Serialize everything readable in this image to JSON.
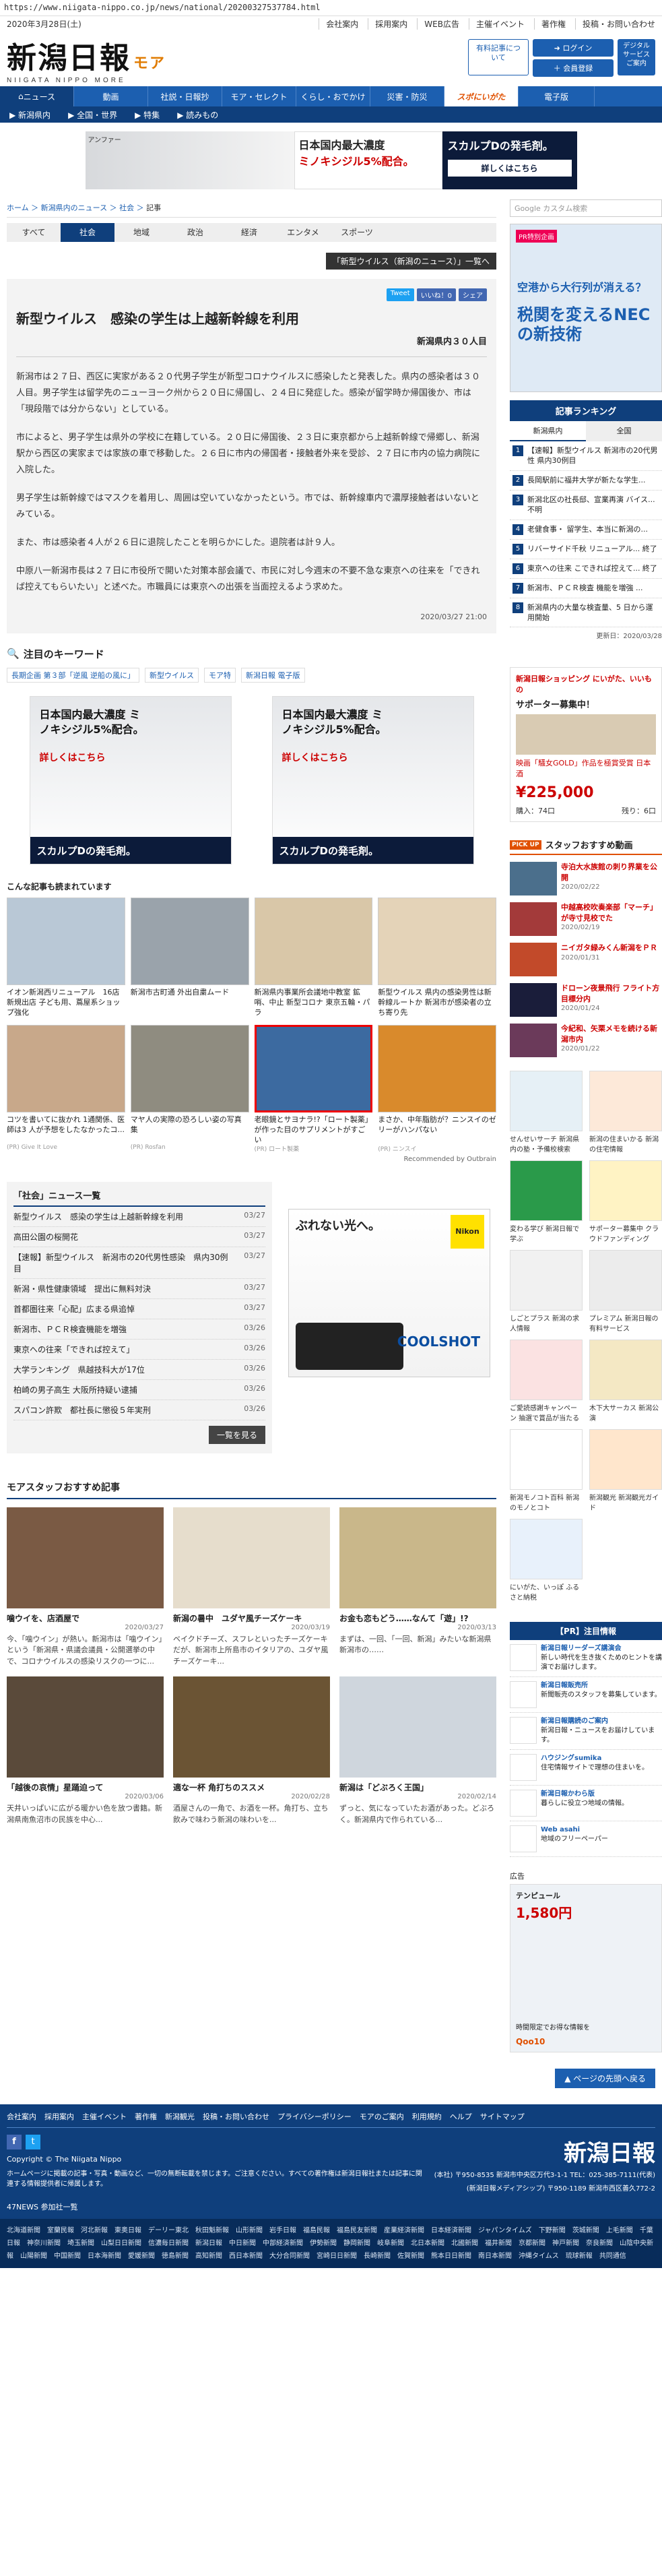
{
  "url": "https://www.niigata-nippo.co.jp/news/national/20200327537784.html",
  "date_display": "2020年3月28日(土)",
  "top_links": [
    "会社案内",
    "採用案内",
    "WEB広告",
    "主催イベント",
    "著作権",
    "投稿・お問い合わせ"
  ],
  "logo": {
    "main": "新潟日報",
    "more": "モア",
    "sub": "NIIGATA NIPPO MORE"
  },
  "header_buttons": {
    "member_check": "有料記事について",
    "login": "ログイン",
    "register": "会員登録",
    "digital": "デジタルサービスご案内"
  },
  "global_nav": [
    "ニュース",
    "動画",
    "社説・日報抄",
    "モア・セレクト",
    "くらし・おでかけ",
    "災害・防災",
    "スポにいがた",
    "電子版"
  ],
  "sub_nav": [
    "新潟県内",
    "全国・世界",
    "特集",
    "読みもの"
  ],
  "top_ad": {
    "brand": "アンファー",
    "headline": "日本国内最大濃度",
    "product": "ミノキシジル5%配合。",
    "cta": "スカルプDの発毛剤。",
    "button": "詳しくはこちら"
  },
  "breadcrumb": [
    "ホーム",
    "新潟県内のニュース",
    "社会",
    "記事"
  ],
  "category_tabs": [
    "すべて",
    "社会",
    "地域",
    "政治",
    "経済",
    "エンタメ",
    "スポーツ"
  ],
  "special_button": "「新型ウイルス（新潟のニュース）」一覧へ",
  "share": {
    "tweet": "Tweet",
    "like": "いいね！0",
    "share": "シェア"
  },
  "article": {
    "title": "新型ウイルス　感染の学生は上越新幹線を利用",
    "subtitle": "新潟県内３０人目",
    "paragraphs": [
      "新潟市は２７日、西区に実家がある２０代男子学生が新型コロナウイルスに感染したと発表した。県内の感染者は３０人目。男子学生は留学先のニューヨーク州から２０日に帰国し、２４日に発症した。感染が留学時か帰国後か、市は「現段階では分からない」としている。",
      "市によると、男子学生は県外の学校に在籍している。２０日に帰国後、２３日に東京都から上越新幹線で帰郷し、新潟駅から西区の実家までは家族の車で移動した。２６日に市内の帰国者・接触者外来を受診、２７日に市内の協力病院に入院した。",
      "男子学生は新幹線ではマスクを着用し、周囲は空いていなかったという。市では、新幹線車内で濃厚接触者はいないとみている。",
      "また、市は感染者４人が２６日に退院したことを明らかにした。退院者は計９人。",
      "中原八一新潟市長は２７日に市役所で開いた対策本部会議で、市民に対し今週末の不要不急な東京への往来を「できれば控えてもらいたい」と述べた。市職員には東京への出張を当面控えるよう求めた。"
    ],
    "date": "2020/03/27 21:00"
  },
  "keywords": {
    "heading": "注目のキーワード",
    "items": [
      "長期企画 第３部「逆風 逆船の風に」",
      "新型ウイルス",
      "モア特",
      "新潟日報 電子版"
    ]
  },
  "mid_ads": [
    {
      "headline": "日本国内最大濃度 ミノキシジル5%配合。",
      "sub": "スカルプDの発毛剤。",
      "button": "詳しくはこちら"
    },
    {
      "headline": "日本国内最大濃度 ミノキシジル5%配合。",
      "sub": "スカルプDの発毛剤。",
      "button": "詳しくはこちら"
    }
  ],
  "recommend": {
    "heading": "こんな記事も読まれています",
    "items": [
      {
        "caption": "イオン新潟西リニューアル　16店新規出店 子ども用、蔦屋系ショップ強化",
        "source": "",
        "color": "#b9c8d6"
      },
      {
        "caption": "新潟市古町通 外出自粛ムード",
        "source": "",
        "color": "#9aa3ab"
      },
      {
        "caption": "新潟県内事業所会議地中教室 鉱哨、中止 新型コロナ 東京五輪・パラ",
        "source": "",
        "color": "#d9c7a8"
      },
      {
        "caption": "新型ウイルス 県内の感染男性は新幹線ルートか 新潟市が感染者の立ち寄り先",
        "source": "",
        "color": "#e4d3b8"
      },
      {
        "caption": "コツを書いてに抜かれ 1通関係、医師は3 人が予想をしたなかったコ...",
        "source": "(PR) Give It Love",
        "color": "#c8a88a"
      },
      {
        "caption": "マヤ人の実際の恐ろしい姿の写真集",
        "source": "(PR) Rosfan",
        "color": "#8f8c80"
      },
      {
        "caption": "老眼鏡とサヨナラ!?「ロート製薬」が作った目のサプリメントがすごい",
        "source": "(PR) ロート製薬",
        "color": "#3c6aa0"
      },
      {
        "caption": "まさか、中年脂肪が？ニンスイのゼリーがハンパない",
        "source": "(PR) ニンスイ",
        "color": "#d98a2c"
      }
    ],
    "recommended_by": "Recommended by Outbrain"
  },
  "news_list": {
    "heading": "「社会」ニュース一覧",
    "rows": [
      {
        "title": "新型ウイルス　感染の学生は上越新幹線を利用",
        "date": "03/27"
      },
      {
        "title": "高田公園の桜開花",
        "date": "03/27"
      },
      {
        "title": "【速報】新型ウイルス　新潟市の20代男性感染　県内30例目",
        "date": "03/27"
      },
      {
        "title": "新潟・県性健康領域　提出に無料対決",
        "date": "03/27"
      },
      {
        "title": "首都圏往来「心配」広まる県追悼",
        "date": "03/27"
      },
      {
        "title": "新潟市、ＰＣＲ検査機能を増強",
        "date": "03/26"
      },
      {
        "title": "東京への往来「できれば控えて」",
        "date": "03/26"
      },
      {
        "title": "大学ランキング　県越技科大が17位",
        "date": "03/26"
      },
      {
        "title": "柏崎の男子高生 大阪所持疑い逮捕",
        "date": "03/26"
      },
      {
        "title": "スパコン許欺　都社長に懲役５年実刑",
        "date": "03/26"
      }
    ],
    "more": "一覧を見る"
  },
  "nikon_ad": {
    "headline": "ぶれない光へ。",
    "brand": "Nikon",
    "product": "COOLSHOT"
  },
  "staff": {
    "heading": "モアスタッフおすすめ記事",
    "items": [
      {
        "title": "噛ウイを、店酒屋で",
        "date": "2020/03/27",
        "desc": "今、「噛ウイン」が熱い。新潟市は「噛ウイン」という「新潟県・県議会議員・公開選挙の中で、コロナウイルスの感染リスクの一つに...",
        "color": "#7a5a44"
      },
      {
        "title": "新潟の暑中　ユダヤ風チーズケーキ",
        "date": "2020/03/19",
        "desc": "ベイクドチーズ、スフレといったチーズケーキだが、新潟市上所島市のイタリアの、ユダヤ風チーズケーキ...",
        "color": "#e6ddcc"
      },
      {
        "title": "お金も恋もどう……なんて「遊」!?",
        "date": "2020/03/13",
        "desc": "まずは、一回、「一回、新潟」みたいな新潟県新潟市の……",
        "color": "#c9b78a"
      },
      {
        "title": "「越後の哀情」星踊迫って",
        "date": "2020/03/06",
        "desc": "天井いっぱいに広がる暖かい色を放つ書籍。新潟県南魚沼市の民族を中心...",
        "color": "#5a4a3a"
      },
      {
        "title": "適な一杯 角打ちのススメ",
        "date": "2020/02/28",
        "desc": "酒屋さんの一角で、お酒を一杯。角打ち、立ち飲みで味わう新潟の味わいを...",
        "color": "#6b5434"
      },
      {
        "title": "新潟は「どぶろく王国」",
        "date": "2020/02/14",
        "desc": "ずっと、気になっていたお酒があった。どぶろく。新潟県内で作られている...",
        "color": "#cfd6dd"
      }
    ]
  },
  "sidebar": {
    "search_placeholder": "Google カスタム検索",
    "ad_top": {
      "tag": "PR特別企画",
      "question": "空港から大行列が消える？",
      "big": "税関を変えるNECの新技術"
    },
    "ranking": {
      "heading": "記事ランキング",
      "tabs": [
        "新潟県内",
        "全国"
      ],
      "items": [
        "【速報】新型ウイルス 新潟市の20代男性 県内30例目",
        "長岡駅前に福井大学が新たな学生...",
        "新潟北区の社長邸、宣業再演 バイス... 不明",
        "老健食事・ 留学生、本当に新潟の...",
        "リバーサイド千秋 リニューアル... 終了",
        "東京への往来 こできれば控えて... 終了",
        "新潟市、ＰＣＲ検査 機能を増強 ...",
        "新潟県内の大量な検査量、5 日から運用開始"
      ],
      "updated": "更新日：2020/03/28"
    },
    "shop": {
      "heading": "新潟日報ショッピング にいがた、いいもの",
      "label": "サポーター募集中！",
      "title": "映画「騒女GOLD」作品を極賞受賞 日本酒",
      "price": "¥225,000",
      "sub_left": "購入：74口",
      "sub_right": "残り：6口"
    },
    "staff_pick": {
      "heading": "スタッフおすすめ動画",
      "items": [
        {
          "title": "寺泊大水族館の刺り界業を公開",
          "date": "2020/02/22",
          "color": "#4b6f8c"
        },
        {
          "title": "中越高校吹奏楽部「マーチ」が寺寸見校でた",
          "date": "2020/02/19",
          "color": "#a33a3a"
        },
        {
          "title": "ニイガタ緑みくん新潟をＰＲ",
          "date": "2020/01/31",
          "color": "#c24a2a"
        },
        {
          "title": "ドローン夜景飛行 フライト方目標分内",
          "date": "2020/01/24",
          "color": "#1a1d3a"
        },
        {
          "title": "今紀和、矢栗メモを続ける新潟市内",
          "date": "2020/01/22",
          "color": "#6b3a5a"
        }
      ]
    },
    "banners": [
      {
        "label": "せんせいサーチ 新潟県内の塾・予備校検索",
        "color": "#e6f0f6"
      },
      {
        "label": "新潟の住まいかる 新潟の住宅情報",
        "color": "#fde9d9"
      },
      {
        "label": "変わる学び 新潟日報で学ぶ",
        "color": "#2a9a4a"
      },
      {
        "label": "サポーター募集中 クラウドファンディング",
        "color": "#fff3c4"
      },
      {
        "label": "しごとプラス 新潟の求人情報",
        "color": "#f1f1f1"
      },
      {
        "label": "プレミアム 新潟日報の有料サービス",
        "color": "#ececec"
      },
      {
        "label": "ご愛読感謝キャンペーン 抽選で賞品が当たる",
        "color": "#fbe2e2"
      },
      {
        "label": "木下大サーカス 新潟公演",
        "color": "#f4e8c4"
      },
      {
        "label": "新潟モノコト百科 新潟のモノとコト",
        "color": "#ffffff"
      },
      {
        "label": "新潟観光 新潟観光ガイド",
        "color": "#ffe6cc"
      },
      {
        "label": "にいがた、いっぽ ふるさと納税",
        "color": "#e8f1fb"
      }
    ],
    "pr_heading": "【PR】注目情報",
    "pr_items": [
      {
        "title": "新潟日報リーダーズ講演会",
        "text": "新しい時代を生き抜くためのヒントを講演でお届けします。"
      },
      {
        "title": "新潟日報販売所",
        "text": "新聞販売のスタッフを募集しています。"
      },
      {
        "title": "新潟日報購読のご案内",
        "text": "新潟日報・ニュースをお届けしています。"
      },
      {
        "title": "ハウジングsumika",
        "text": "住宅情報サイトで理想の住まいを。"
      },
      {
        "title": "新潟日報かわら版",
        "text": "暮らしに役立つ地域の情報。"
      },
      {
        "title": "Web asahi",
        "text": "地域のフリーペーパー"
      }
    ],
    "ad_label": "広告",
    "tempur": {
      "brand": "テンピュール",
      "price": "1,580円",
      "caption": "時間限定でお得な情報を",
      "logo": "Qoo10"
    }
  },
  "pagetop": "ページの先頭へ戻る",
  "footer": {
    "links": [
      "会社案内",
      "採用案内",
      "主催イベント",
      "著作権",
      "新潟観光",
      "投稿・お問い合わせ",
      "プライバシーポリシー",
      "モアのご案内",
      "利用規約",
      "ヘルプ",
      "サイトマップ"
    ],
    "copyright": "Copyright © The Niigata Nippo",
    "note": "ホームページに掲載の記事・写真・動画など、一切の無断転載を禁じます。ご注意ください。すべての著作権は新潟日報社または記事に関連する情報提供者に帰属します。",
    "logo": "新潟日報",
    "address": "(本社) 〒950-8535 新潟市中央区万代3-1-1 TEL：025-385-7111(代表)",
    "address2": "(新潟日報メディアシップ) 〒950-1189 新潟市西区善久772-2",
    "news47": "47NEWS 参加社一覧",
    "network": [
      "北海道新聞",
      "室蘭民報",
      "河北新報",
      "東奥日報",
      "デーリー東北",
      "秋田魁新報",
      "山形新聞",
      "岩手日報",
      "福島民報",
      "福島民友新聞",
      "産業経済新聞",
      "日本経済新聞",
      "ジャパンタイムズ",
      "下野新聞",
      "茨城新聞",
      "上毛新聞",
      "千葉日報",
      "神奈川新聞",
      "埼玉新聞",
      "山梨日日新聞",
      "信濃毎日新聞",
      "新潟日報",
      "中日新聞",
      "中部経済新聞",
      "伊勢新聞",
      "静岡新聞",
      "岐阜新聞",
      "北日本新聞",
      "北國新聞",
      "福井新聞",
      "京都新聞",
      "神戸新聞",
      "奈良新聞",
      "山陰中央新報",
      "山陽新聞",
      "中国新聞",
      "日本海新聞",
      "愛媛新聞",
      "徳島新聞",
      "高知新聞",
      "西日本新聞",
      "大分合同新聞",
      "宮崎日日新聞",
      "長崎新聞",
      "佐賀新聞",
      "熊本日日新聞",
      "南日本新聞",
      "沖縄タイムス",
      "琉球新報",
      "共同通信"
    ]
  }
}
